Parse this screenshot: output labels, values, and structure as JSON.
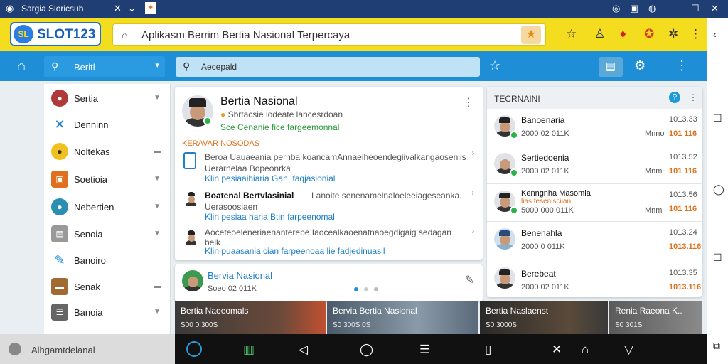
{
  "window": {
    "title": "Sargia Sloricsuh"
  },
  "header": {
    "logo_badge": "SL",
    "logo_text": "SLOT123",
    "url_text": "Aplikasm Berrim Bertia Nasional Terpercaya"
  },
  "nav": {
    "side_search": "Beritl",
    "main_search": "Aecepald"
  },
  "sidebar": {
    "items": [
      {
        "label": "Sertia"
      },
      {
        "label": "Denninn"
      },
      {
        "label": "Noltekas"
      },
      {
        "label": "Soetioia"
      },
      {
        "label": "Nebertien"
      },
      {
        "label": "Senoia"
      },
      {
        "label": "Banoiro"
      },
      {
        "label": "Senak"
      },
      {
        "label": "Banoia"
      }
    ]
  },
  "feed": {
    "post_title": "Bertia Nasional",
    "post_line1": "Sbrtacsie lodeate lancesrdoan",
    "post_line2": "Sce Cenanie fice fargeemonnal",
    "section_label": "KERAVAR NOSODAS",
    "items": [
      {
        "text": "Beroa Uauaeania pernba koancamAnnaeiheoendegiivalkangaoseniis",
        "text2": "Uerarnelaa Bopeonrka",
        "link": "Klin pesiaaihiaria Gan, faqjasionial"
      },
      {
        "title": "Boatenal Bertvlasinial",
        "text": "Lanoite senenamelnaloeleeiageseanka.",
        "text2": "Uerasoosiaen",
        "link": "Klin pesiaa haria Btin farpeenomal"
      },
      {
        "text": "Aoceteoeleneriaenanterepe Iaocealkaoenatnaoegdigaig sedagan",
        "text2": "belk",
        "link": "Klin puaasania cian farpeenoaa lie fadjedinuasil"
      }
    ]
  },
  "card2": {
    "title": "Bervia Nasional",
    "meta": "Soeo 02 011K"
  },
  "thumbs": [
    {
      "label": "Bertia Naoeomals",
      "sub": "S00 0 300S"
    },
    {
      "label": "Bervia Bertia Nasional",
      "sub": "S0 300S 0S"
    },
    {
      "label": "Bertia Naslaenst",
      "sub": "S0 3000S"
    },
    {
      "label": "Renia Raeona K..",
      "sub": "S0 301S"
    }
  ],
  "rpanel": {
    "title": "TECRNAINI",
    "rows": [
      {
        "name": "Banoenaria",
        "meta": "2000 02 011K",
        "right_tag": "Mnno",
        "time": "1013.33",
        "amount": "101 116"
      },
      {
        "name": "Sertiedoenia",
        "meta": "2000 02 011K",
        "right_tag": "Mnm",
        "time": "1013.52",
        "amount": "101 116"
      },
      {
        "name": "Kenngnha Masomia",
        "meta": "5000 000 011K",
        "extra": "lias fesenlsciian",
        "right_tag": "Mnm",
        "time": "1013.56",
        "amount": "101 116"
      },
      {
        "name": "Benenahla",
        "meta": "2000 0 011K",
        "right_tag": "",
        "time": "1013.24",
        "amount": "1013.116"
      },
      {
        "name": "Berebeat",
        "meta": "2000 02 011K",
        "right_tag": "",
        "time": "1013.35",
        "amount": "1013.116"
      }
    ]
  },
  "bottom": {
    "left_label": "Alhgamtdelanal"
  },
  "colors": {
    "header_yellow": "#f4dc1e",
    "nav_blue": "#1e8fd6",
    "sys_navy": "#1f3e73",
    "accent_orange": "#e0701a"
  }
}
